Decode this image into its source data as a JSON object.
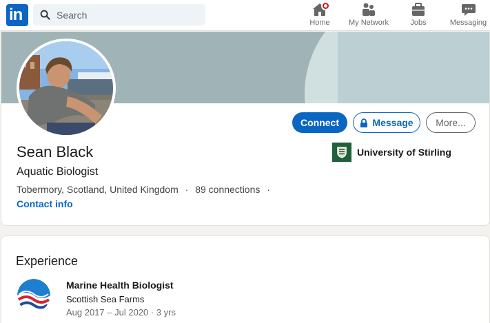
{
  "nav": {
    "logo_text": "in",
    "search_placeholder": "Search",
    "items": [
      {
        "label": "Home",
        "icon": "home-icon"
      },
      {
        "label": "My Network",
        "icon": "network-icon"
      },
      {
        "label": "Jobs",
        "icon": "briefcase-icon"
      },
      {
        "label": "Messaging",
        "icon": "messaging-icon"
      }
    ]
  },
  "profile": {
    "name": "Sean Black",
    "headline": "Aquatic Biologist",
    "location": "Tobermory, Scotland, United Kingdom",
    "connections": "89 connections",
    "contact_info": "Contact info",
    "buttons": {
      "connect": "Connect",
      "message": "Message",
      "more": "More..."
    },
    "education": "University of Stirling"
  },
  "experience": {
    "title": "Experience",
    "items": [
      {
        "role": "Marine Health Biologist",
        "company": "Scottish Sea Farms",
        "dates": "Aug 2017 – Jul 2020 · 3 yrs"
      }
    ]
  },
  "colors": {
    "brand": "#0a66c2",
    "notification": "#cc1016",
    "school_logo": "#1f5f3a"
  }
}
